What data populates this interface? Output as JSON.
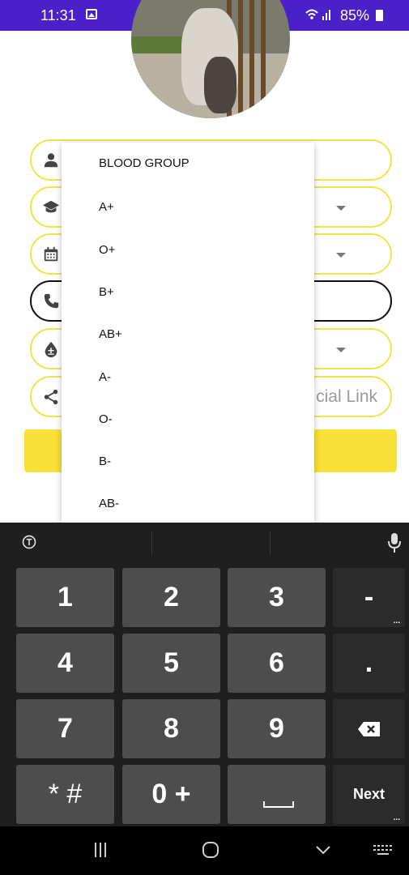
{
  "status_bar": {
    "time": "11:31",
    "battery": "85%",
    "background": "#4a21c9"
  },
  "form": {
    "accent_color": "#f5e24a",
    "fields": [
      {
        "icon": "person-icon"
      },
      {
        "icon": "graduation-cap-icon"
      },
      {
        "icon": "calendar-icon"
      },
      {
        "icon": "phone-icon"
      },
      {
        "icon": "blood-drop-icon"
      },
      {
        "icon": "share-icon",
        "hint_visible": "cial Link"
      }
    ],
    "submit_color": "#fae139"
  },
  "menu": {
    "items": [
      "BLOOD GROUP",
      "A+",
      "O+",
      "B+",
      "AB+",
      "A-",
      "O-",
      "B-",
      "AB-"
    ]
  },
  "keyboard": {
    "rows": [
      [
        "1",
        "2",
        "3",
        "-"
      ],
      [
        "4",
        "5",
        "6",
        "."
      ],
      [
        "7",
        "8",
        "9",
        ""
      ],
      [
        "* #",
        "0 +",
        "",
        "Next"
      ]
    ],
    "next_label": "Next"
  }
}
